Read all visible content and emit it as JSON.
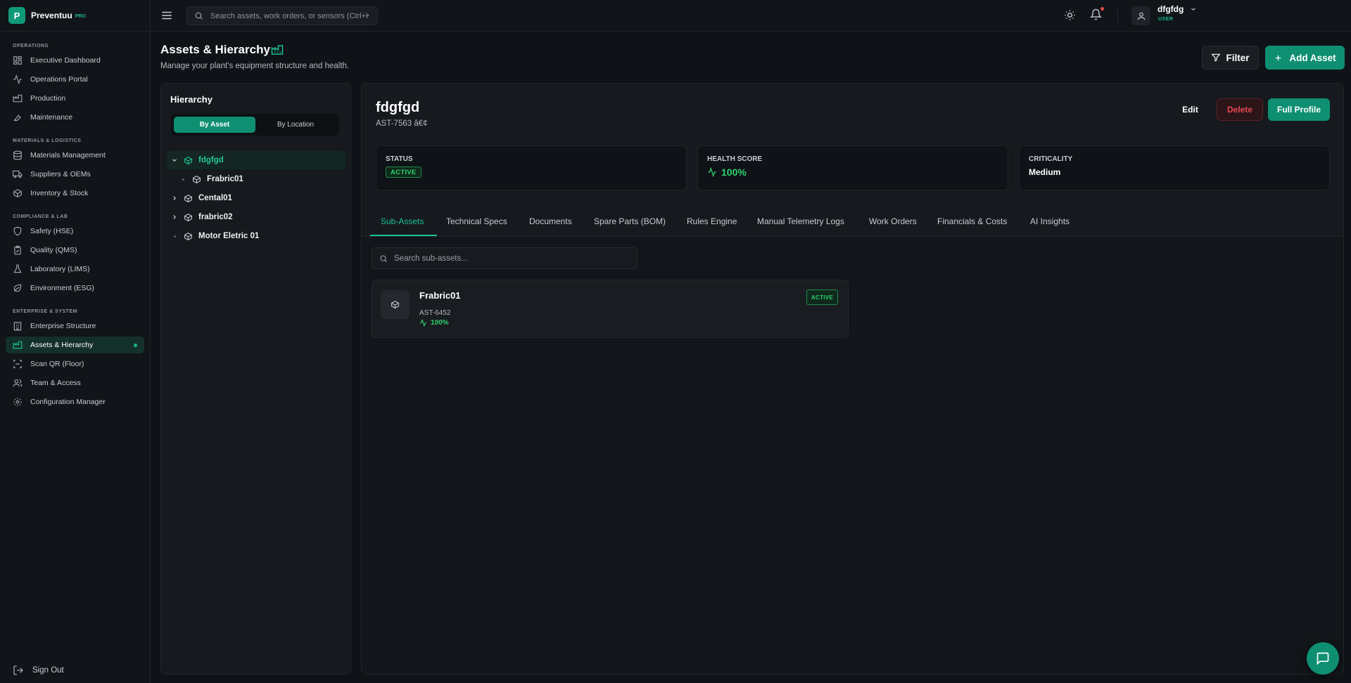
{
  "brand": {
    "name": "Preventuu",
    "badge": "PRO",
    "logo_letter": "P"
  },
  "topbar": {
    "search_placeholder": "Search assets, work orders, or sensors (Ctrl+K)",
    "user": {
      "name": "dfgfdg",
      "role": "USER"
    }
  },
  "sidebar": {
    "sections": [
      {
        "title": "OPERATIONS",
        "items": [
          {
            "label": "Executive Dashboard",
            "icon": "dashboard-icon"
          },
          {
            "label": "Operations Portal",
            "icon": "activity-icon"
          },
          {
            "label": "Production",
            "icon": "factory-icon"
          },
          {
            "label": "Maintenance",
            "icon": "wrench-icon"
          }
        ]
      },
      {
        "title": "MATERIALS & LOGISTICS",
        "items": [
          {
            "label": "Materials Management",
            "icon": "database-icon"
          },
          {
            "label": "Suppliers & OEMs",
            "icon": "truck-icon"
          },
          {
            "label": "Inventory & Stock",
            "icon": "box-icon"
          }
        ]
      },
      {
        "title": "COMPLIANCE & LAB",
        "items": [
          {
            "label": "Safety (HSE)",
            "icon": "shield-icon"
          },
          {
            "label": "Quality (QMS)",
            "icon": "clipboard-icon"
          },
          {
            "label": "Laboratory (LIMS)",
            "icon": "flask-icon"
          },
          {
            "label": "Environment (ESG)",
            "icon": "leaf-icon"
          }
        ]
      },
      {
        "title": "ENTERPRISE & SYSTEM",
        "items": [
          {
            "label": "Enterprise Structure",
            "icon": "building-icon"
          },
          {
            "label": "Assets & Hierarchy",
            "icon": "factory-icon",
            "active": true
          },
          {
            "label": "Scan QR (Floor)",
            "icon": "scan-icon"
          },
          {
            "label": "Team & Access",
            "icon": "users-icon"
          },
          {
            "label": "Configuration Manager",
            "icon": "settings-icon"
          }
        ]
      }
    ],
    "sign_out": "Sign Out"
  },
  "page": {
    "title": "Assets & Hierarchy",
    "subtitle": "Manage your plant's equipment structure and health.",
    "filter_label": "Filter",
    "add_label": "Add Asset"
  },
  "hierarchy": {
    "title": "Hierarchy",
    "modes": [
      "By Asset",
      "By Location"
    ],
    "active_mode": "By Asset",
    "tree": [
      {
        "label": "fdgfgd",
        "expanded": true,
        "selected": true
      },
      {
        "label": "Frabric01",
        "child": true
      },
      {
        "label": "Cental01"
      },
      {
        "label": "frabric02"
      },
      {
        "label": "Motor Eletric 01",
        "leaf": true
      }
    ]
  },
  "asset": {
    "name": "fdgfgd",
    "id_line": "AST-7563 â€¢",
    "actions": {
      "edit": "Edit",
      "delete": "Delete",
      "profile": "Full Profile"
    },
    "stats": {
      "status_label": "STATUS",
      "status_value": "ACTIVE",
      "health_label": "HEALTH SCORE",
      "health_value": "100%",
      "criticality_label": "CRITICALITY",
      "criticality_value": "Medium"
    },
    "tabs": [
      "Sub-Assets",
      "Technical Specs",
      "Documents",
      "Spare Parts (BOM)",
      "Rules Engine",
      "Manual Telemetry Logs",
      "Work Orders",
      "Financials & Costs",
      "AI Insights"
    ],
    "active_tab": "Sub-Assets",
    "sub_search_placeholder": "Search sub-assets...",
    "sub_assets": [
      {
        "name": "Frabric01",
        "id": "AST-6452",
        "health": "100%",
        "status": "ACTIVE"
      }
    ]
  },
  "colors": {
    "accent": "#0f8f72",
    "accent_text": "#19c394",
    "success": "#2ed16f",
    "danger": "#e5484d",
    "bg": "#0f1216"
  }
}
